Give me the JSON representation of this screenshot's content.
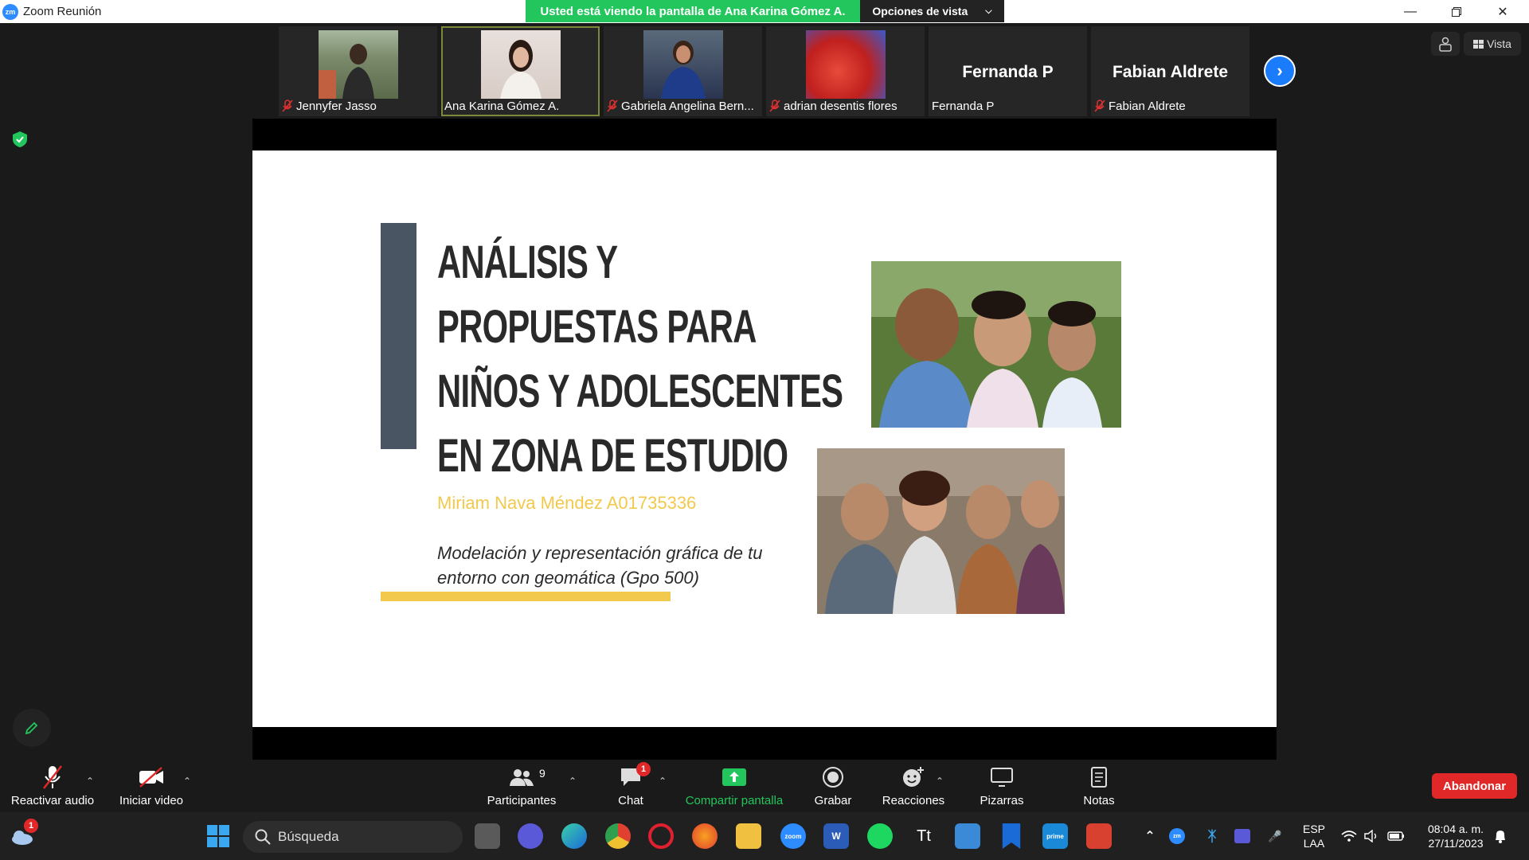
{
  "window": {
    "title": "Zoom Reunión",
    "logo_text": "zm",
    "share_banner": "Usted está viendo la pantalla de Ana Karina Gómez A.",
    "view_options": "Opciones de vista",
    "view_label": "Vista"
  },
  "participants_strip": [
    {
      "label": "Jennyfer Jasso",
      "muted": true,
      "type": "photo",
      "color": "#6a7a5a"
    },
    {
      "label": "Ana Karina Gómez A.",
      "muted": false,
      "type": "photo",
      "color": "#d8c8c0"
    },
    {
      "label": "Gabriela Angelina Bern...",
      "muted": true,
      "type": "photo",
      "color": "#3a4a7a"
    },
    {
      "label": "adrian desentis flores",
      "muted": true,
      "type": "photo",
      "color": "#d02a2a"
    },
    {
      "label": "Fernanda P",
      "muted": false,
      "type": "name",
      "name": "Fernanda P"
    },
    {
      "label": "Fabian Aldrete",
      "muted": true,
      "type": "name",
      "name": "Fabian Aldrete"
    }
  ],
  "slide": {
    "title_lines": [
      "ANÁLISIS Y",
      "PROPUESTAS PARA",
      "NIÑOS Y ADOLESCENTES",
      "EN ZONA DE ESTUDIO"
    ],
    "author": "Miriam Nava Méndez A01735336",
    "course_lines": [
      "Modelación y representación gráfica de tu",
      "entorno con geomática (Gpo 500)"
    ],
    "accent_color": "#f2c94c",
    "bar_color": "#4a5563"
  },
  "toolbar": {
    "audio": "Reactivar audio",
    "video": "Iniciar video",
    "participants": "Participantes",
    "participants_count": "9",
    "chat": "Chat",
    "chat_badge": "1",
    "share": "Compartir pantalla",
    "record": "Grabar",
    "reactions": "Reacciones",
    "whiteboards": "Pizarras",
    "notes": "Notas",
    "leave": "Abandonar"
  },
  "taskbar": {
    "search_placeholder": "Búsqueda",
    "weather_badge": "1",
    "lang_top": "ESP",
    "lang_bottom": "LAA",
    "time": "08:04 a. m.",
    "date": "27/11/2023"
  },
  "colors": {
    "zoom_blue": "#2d8cff",
    "share_green": "#23c65c",
    "leave_red": "#e02828"
  }
}
